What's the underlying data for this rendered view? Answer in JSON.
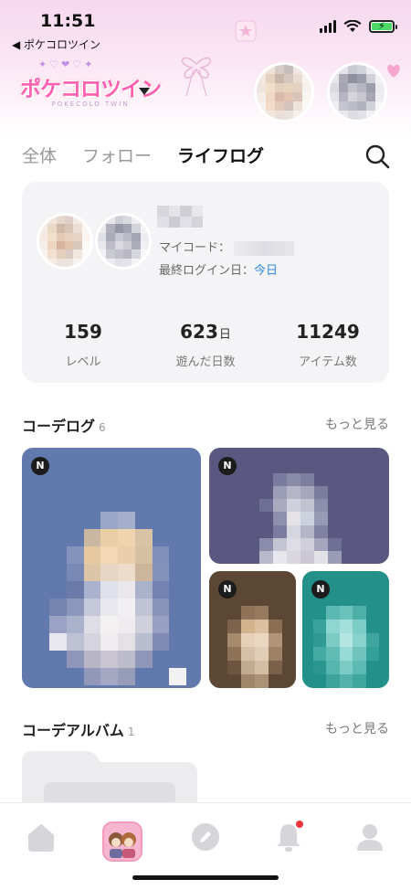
{
  "status_bar": {
    "time": "11:51",
    "back_label": "◀ ポケコロツイン"
  },
  "app": {
    "logo_text": "ポケコロツイン",
    "logo_sub": "POKECOLO TWIN",
    "logo_hearts": "✦♡❤♡✦"
  },
  "tabs": [
    {
      "label": "全体",
      "active": false
    },
    {
      "label": "フォロー",
      "active": false
    },
    {
      "label": "ライフログ",
      "active": true
    }
  ],
  "profile": {
    "my_code_label": "マイコード：",
    "last_login_label": "最終ログイン日：",
    "last_login_value": "今日",
    "stats": [
      {
        "value": "159",
        "unit": "",
        "label": "レベル"
      },
      {
        "value": "623",
        "unit": "日",
        "label": "遊んだ日数"
      },
      {
        "value": "11249",
        "unit": "",
        "label": "アイテム数"
      }
    ]
  },
  "code_log": {
    "title": "コーデログ",
    "count": "6",
    "more_label": "もっと見る",
    "badge": "N",
    "tiles": [
      {
        "bg": "#6279ae"
      },
      {
        "bg": "#5a5781"
      },
      {
        "bg": "#5c4734"
      },
      {
        "bg": "#23908a"
      }
    ]
  },
  "album": {
    "title": "コーデアルバム",
    "count": "1",
    "more_label": "もっと見る"
  },
  "bottom_nav": {
    "items": [
      "home-icon",
      "avatar-icon",
      "pencil-icon",
      "bell-icon",
      "profile-icon"
    ],
    "notification_color": "#e8343a"
  },
  "colors": {
    "accent_link": "#2e8ae6",
    "brand_pink": "#ff5fb0"
  }
}
